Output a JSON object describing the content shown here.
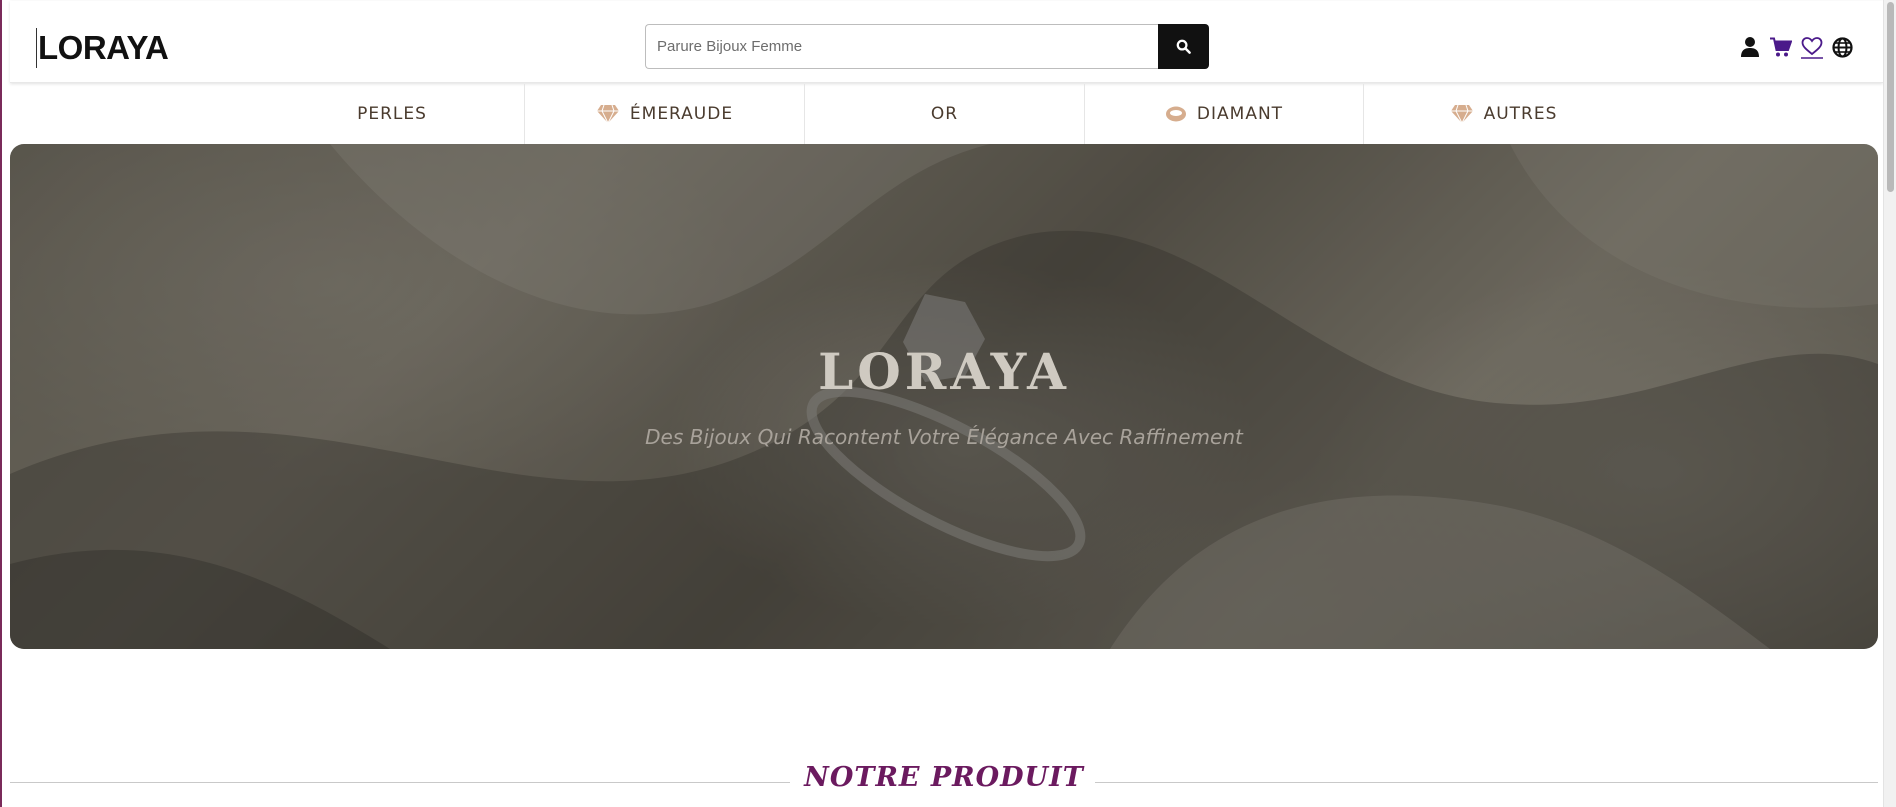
{
  "header": {
    "logo": "LORAYA",
    "search": {
      "placeholder": "Parure Bijoux Femme",
      "value": ""
    },
    "icons": [
      "user-icon",
      "cart-icon",
      "heart-icon",
      "globe-icon"
    ]
  },
  "nav": {
    "items": [
      {
        "label": "PERLES",
        "icon": ""
      },
      {
        "label": "ÉMERAUDE",
        "icon": "diamond-icon"
      },
      {
        "label": "OR",
        "icon": ""
      },
      {
        "label": "DIAMANT",
        "icon": "ring-icon"
      },
      {
        "label": "AUTRES",
        "icon": "diamond-icon"
      }
    ]
  },
  "hero": {
    "title": "LORAYA",
    "tagline": "Des Bijoux Qui Racontent Votre Élégance Avec Raffinement"
  },
  "section": {
    "title": "NOTRE PRODUIT"
  },
  "colors": {
    "accent": "#6b1a5f",
    "nav_text": "#4a3b2e",
    "nav_icon": "#c99a7a",
    "cart": "#4b1a8a",
    "search_button": "#111111"
  }
}
